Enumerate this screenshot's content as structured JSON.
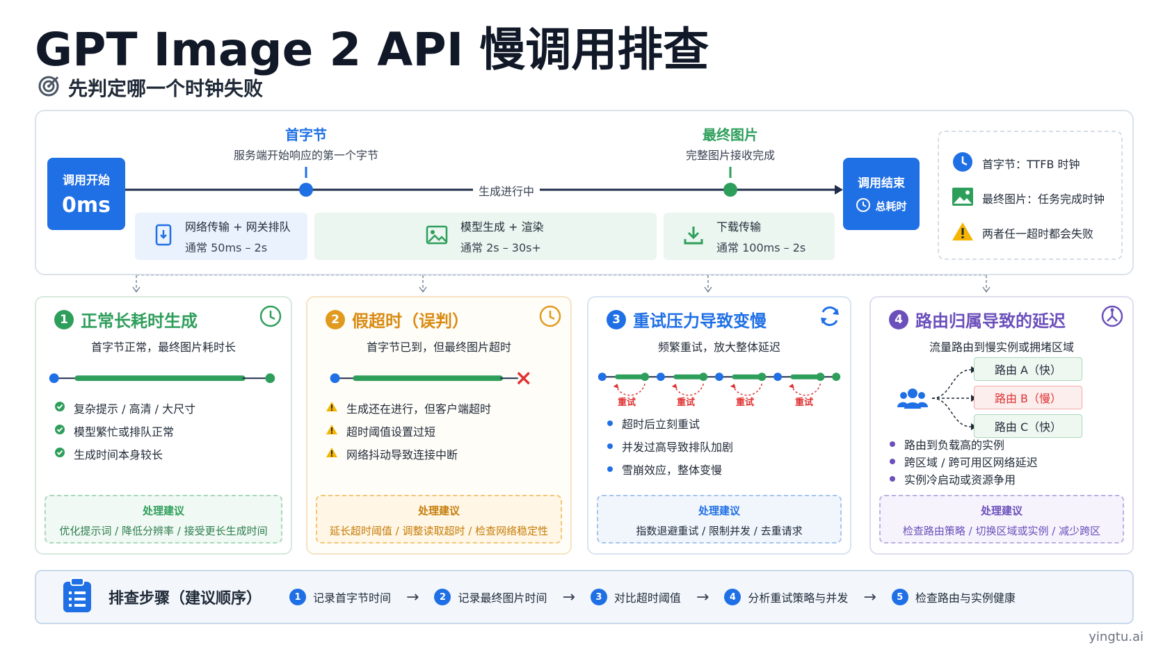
{
  "title": "GPT Image 2 API 慢调用排查",
  "subtitle": "先判定哪一个时钟失败",
  "timeline": {
    "start_label": "调用开始",
    "start_value": "0ms",
    "first_byte_title": "首字节",
    "first_byte_desc": "服务端开始响应的第一个字节",
    "final_image_title": "最终图片",
    "final_image_desc": "完整图片接收完成",
    "progress_label": "生成进行中",
    "end_label": "调用结束",
    "end_total": "总耗时",
    "phases": [
      {
        "title": "网络传输 + 网关排队",
        "desc": "通常 50ms – 2s",
        "icon": "phone-network-icon"
      },
      {
        "title": "模型生成 + 渲染",
        "desc": "通常 2s – 30s+",
        "icon": "image-icon"
      },
      {
        "title": "下载传输",
        "desc": "通常 100ms – 2s",
        "icon": "download-icon"
      }
    ]
  },
  "legend": [
    {
      "text": "首字节：TTFB 时钟",
      "icon": "clock-icon"
    },
    {
      "text": "最终图片：任务完成时钟",
      "icon": "image-icon"
    },
    {
      "text": "两者任一超时都会失败",
      "icon": "warning-icon"
    }
  ],
  "cards": [
    {
      "num": "1",
      "title": "正常长耗时生成",
      "sub": "首字节正常，最终图片耗时长",
      "bullets": [
        "复杂提示 / 高清 / 大尺寸",
        "模型繁忙或排队正常",
        "生成时间本身较长"
      ],
      "advice_title": "处理建议",
      "advice": "优化提示词 / 降低分辨率 / 接受更长生成时间"
    },
    {
      "num": "2",
      "title": "假超时（误判）",
      "sub": "首字节已到，但最终图片超时",
      "bullets": [
        "生成还在进行，但客户端超时",
        "超时阈值设置过短",
        "网络抖动导致连接中断"
      ],
      "advice_title": "处理建议",
      "advice": "延长超时阈值 / 调整读取超时 / 检查网络稳定性"
    },
    {
      "num": "3",
      "title": "重试压力导致变慢",
      "sub": "频繁重试，放大整体延迟",
      "retry_label": "重试",
      "bullets": [
        "超时后立刻重试",
        "并发过高导致排队加剧",
        "雪崩效应，整体变慢"
      ],
      "advice_title": "处理建议",
      "advice": "指数退避重试 / 限制并发 / 去重请求"
    },
    {
      "num": "4",
      "title": "路由归属导致的延迟",
      "sub": "流量路由到慢实例或拥堵区域",
      "routes": [
        "路由 A（快）",
        "路由 B（慢）",
        "路由 C（快）"
      ],
      "bullets": [
        "路由到负载高的实例",
        "跨区域 / 跨可用区网络延迟",
        "实例冷启动或资源争用"
      ],
      "advice_title": "处理建议",
      "advice": "检查路由策略 / 切换区域或实例 / 减少跨区"
    }
  ],
  "steps": {
    "title": "排查步骤（建议顺序）",
    "items": [
      {
        "num": "1",
        "text": "记录首字节时间"
      },
      {
        "num": "2",
        "text": "记录最终图片时间"
      },
      {
        "num": "3",
        "text": "对比超时阈值"
      },
      {
        "num": "4",
        "text": "分析重试策略与并发"
      },
      {
        "num": "5",
        "text": "检查路由与实例健康"
      }
    ]
  },
  "watermark": "yingtu.ai",
  "colors": {
    "blue": "#1f6fe5",
    "green": "#2e9e5b",
    "orange": "#e09a1e",
    "red": "#e03131",
    "purple": "#6b4fbb"
  }
}
